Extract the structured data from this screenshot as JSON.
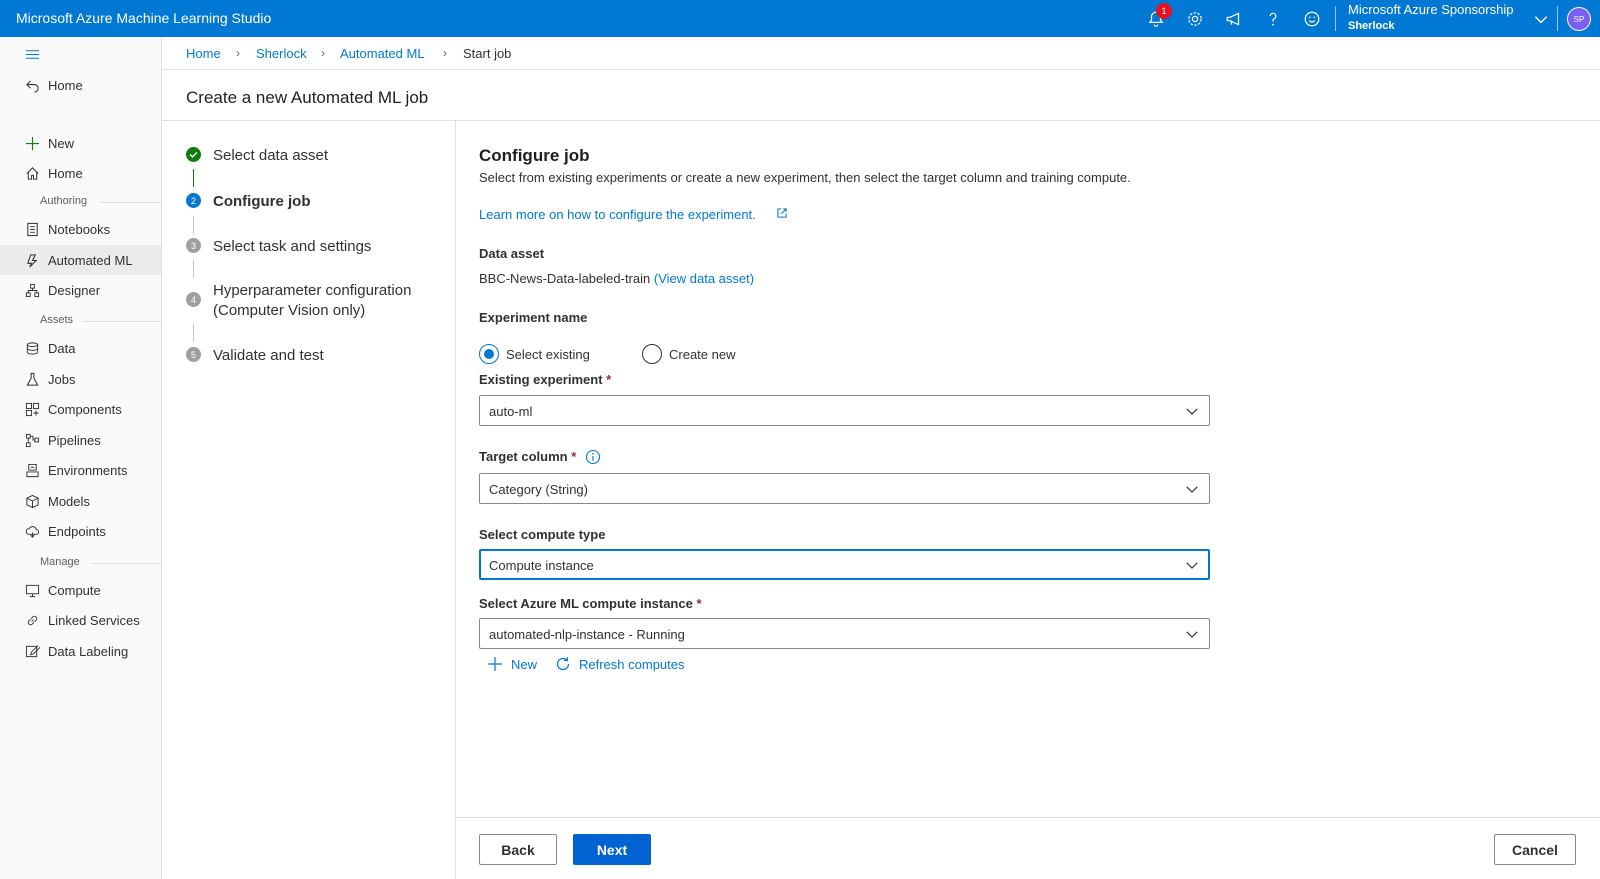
{
  "app": {
    "title": "Microsoft Azure Machine Learning Studio",
    "notification_count": "1",
    "account_name": "Microsoft Azure Sponsorship",
    "account_directory": "Sherlock",
    "avatar_initials": "SP",
    "brand_color": "#0078d4"
  },
  "nav": {
    "back_home": "Home",
    "items": {
      "new": "New",
      "home": "Home",
      "notebooks": "Notebooks",
      "automated_ml": "Automated ML",
      "designer": "Designer",
      "data": "Data",
      "jobs": "Jobs",
      "components": "Components",
      "pipelines": "Pipelines",
      "environments": "Environments",
      "models": "Models",
      "endpoints": "Endpoints",
      "compute": "Compute",
      "linked_services": "Linked Services",
      "data_labeling": "Data Labeling"
    },
    "sections": {
      "authoring": "Authoring",
      "assets": "Assets",
      "manage": "Manage"
    }
  },
  "breadcrumb": [
    "Home",
    "Sherlock",
    "Automated ML",
    "Start job"
  ],
  "page_title": "Create a new Automated ML job",
  "steps": [
    {
      "number": "1",
      "label": "Select data asset",
      "status": "complete"
    },
    {
      "number": "2",
      "label": "Configure job",
      "status": "current"
    },
    {
      "number": "3",
      "label": "Select task and settings",
      "status": "pending"
    },
    {
      "number": "4",
      "label": "Hyperparameter configuration",
      "label2": "(Computer Vision only)",
      "status": "pending"
    },
    {
      "number": "5",
      "label": "Validate and test",
      "status": "pending"
    }
  ],
  "form": {
    "title": "Configure job",
    "description": "Select from existing experiments or create a new experiment, then select the target column and training compute.",
    "learn_more": "Learn more on how to configure the experiment.",
    "data_asset_label": "Data asset",
    "data_asset_value": "BBC-News-Data-labeled-train",
    "data_asset_link": "(View data asset)",
    "experiment_name_label": "Experiment name",
    "radio_select_existing": "Select existing",
    "radio_create_new": "Create new",
    "existing_experiment_label": "Existing experiment",
    "existing_experiment_value": "auto-ml",
    "target_column_label": "Target column",
    "target_column_value": "Category (String)",
    "compute_type_label": "Select compute type",
    "compute_type_value": "Compute instance",
    "compute_instance_label": "Select Azure ML compute instance",
    "compute_instance_value": "automated-nlp-instance - Running",
    "new_label": "New",
    "refresh_label": "Refresh computes",
    "required_marker": "*"
  },
  "buttons": {
    "back": "Back",
    "next": "Next",
    "cancel": "Cancel"
  }
}
